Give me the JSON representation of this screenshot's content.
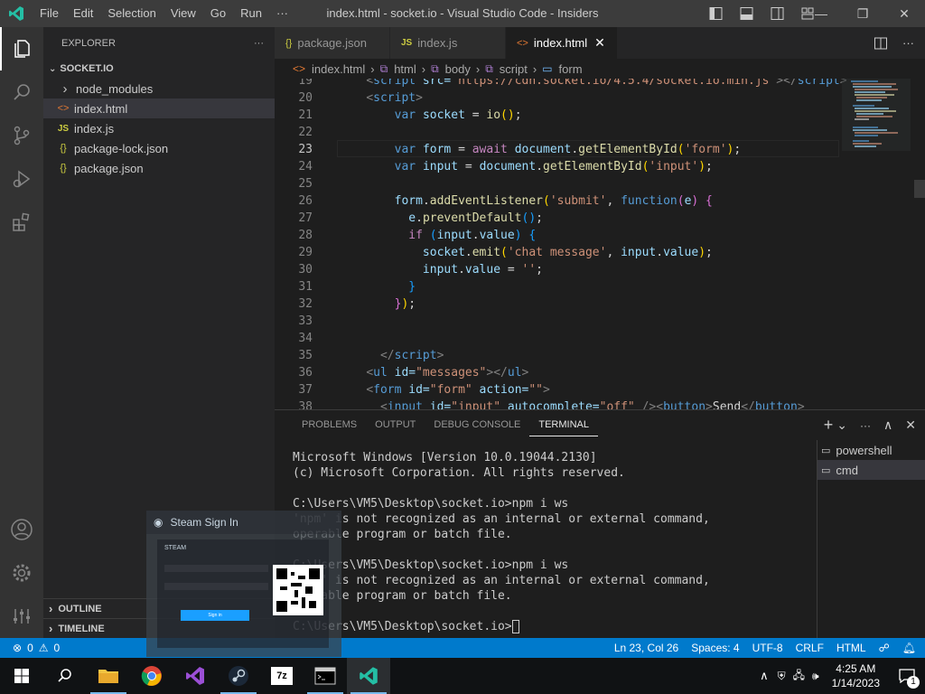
{
  "window": {
    "title": "index.html - socket.io - Visual Studio Code - Insiders",
    "menu": [
      "File",
      "Edit",
      "Selection",
      "View",
      "Go",
      "Run",
      "···"
    ]
  },
  "sidebar": {
    "title": "EXPLORER",
    "more": "···",
    "folder": "SOCKET.IO",
    "items": [
      {
        "label": "node_modules",
        "icon": "chevron-right-icon",
        "glyph": "›"
      },
      {
        "label": "index.html",
        "icon": "html-file-icon",
        "glyph": "<>"
      },
      {
        "label": "index.js",
        "icon": "js-file-icon",
        "glyph": "JS"
      },
      {
        "label": "package-lock.json",
        "icon": "json-file-icon",
        "glyph": "{}"
      },
      {
        "label": "package.json",
        "icon": "json-file-icon",
        "glyph": "{}"
      }
    ],
    "outline": "OUTLINE",
    "timeline": "TIMELINE"
  },
  "tabs": [
    {
      "label": "package.json",
      "glyph": "{}"
    },
    {
      "label": "index.js",
      "glyph": "JS"
    },
    {
      "label": "index.html",
      "glyph": "<>",
      "close": "✕"
    }
  ],
  "breadcrumbs": [
    "index.html",
    "html",
    "body",
    "script",
    "form"
  ],
  "editor": {
    "current_line": 23,
    "lines": [
      {
        "n": "19",
        "t": [
          [
            "    ",
            "t-pl"
          ],
          [
            "<",
            "t-br"
          ],
          [
            "script",
            "t-tag"
          ],
          [
            " src=",
            "t-attr"
          ],
          [
            "\"https://cdn.socket.io/4.5.4/socket.io.min.js\"",
            "t-str"
          ],
          [
            "></",
            "t-br"
          ],
          [
            "script",
            "t-tag"
          ],
          [
            ">",
            "t-br"
          ]
        ]
      },
      {
        "n": "20",
        "t": [
          [
            "    ",
            "t-pl"
          ],
          [
            "<",
            "t-br"
          ],
          [
            "script",
            "t-tag"
          ],
          [
            ">",
            "t-br"
          ]
        ]
      },
      {
        "n": "21",
        "t": [
          [
            "        ",
            "t-pl"
          ],
          [
            "var ",
            "t-kw"
          ],
          [
            "socket",
            "t-var"
          ],
          [
            " = ",
            "t-pl"
          ],
          [
            "io",
            "t-fn"
          ],
          [
            "()",
            "t-p1"
          ],
          [
            ";",
            "t-pl"
          ]
        ]
      },
      {
        "n": "22",
        "t": [
          [
            "",
            "t-pl"
          ]
        ]
      },
      {
        "n": "23",
        "t": [
          [
            "        ",
            "t-pl"
          ],
          [
            "var ",
            "t-kw"
          ],
          [
            "form",
            "t-var"
          ],
          [
            " = ",
            "t-pl"
          ],
          [
            "await ",
            "t-ctl"
          ],
          [
            "document",
            "t-var"
          ],
          [
            ".",
            "t-pl"
          ],
          [
            "getElementById",
            "t-fn"
          ],
          [
            "(",
            "t-p1"
          ],
          [
            "'form'",
            "t-str"
          ],
          [
            ")",
            "t-p1"
          ],
          [
            ";",
            "t-pl"
          ]
        ]
      },
      {
        "n": "24",
        "t": [
          [
            "        ",
            "t-pl"
          ],
          [
            "var ",
            "t-kw"
          ],
          [
            "input",
            "t-var"
          ],
          [
            " = ",
            "t-pl"
          ],
          [
            "document",
            "t-var"
          ],
          [
            ".",
            "t-pl"
          ],
          [
            "getElementById",
            "t-fn"
          ],
          [
            "(",
            "t-p1"
          ],
          [
            "'input'",
            "t-str"
          ],
          [
            ")",
            "t-p1"
          ],
          [
            ";",
            "t-pl"
          ]
        ]
      },
      {
        "n": "25",
        "t": [
          [
            "",
            "t-pl"
          ]
        ]
      },
      {
        "n": "26",
        "t": [
          [
            "        ",
            "t-pl"
          ],
          [
            "form",
            "t-var"
          ],
          [
            ".",
            "t-pl"
          ],
          [
            "addEventListener",
            "t-fn"
          ],
          [
            "(",
            "t-p1"
          ],
          [
            "'submit'",
            "t-str"
          ],
          [
            ", ",
            "t-pl"
          ],
          [
            "function",
            "t-kw"
          ],
          [
            "(",
            "t-p2"
          ],
          [
            "e",
            "t-var"
          ],
          [
            ")",
            "t-p2"
          ],
          [
            " {",
            "t-p2"
          ]
        ]
      },
      {
        "n": "27",
        "t": [
          [
            "          ",
            "t-pl"
          ],
          [
            "e",
            "t-var"
          ],
          [
            ".",
            "t-pl"
          ],
          [
            "preventDefault",
            "t-fn"
          ],
          [
            "()",
            "t-p3"
          ],
          [
            ";",
            "t-pl"
          ]
        ]
      },
      {
        "n": "28",
        "t": [
          [
            "          ",
            "t-pl"
          ],
          [
            "if ",
            "t-ctl"
          ],
          [
            "(",
            "t-p3"
          ],
          [
            "input",
            "t-var"
          ],
          [
            ".",
            "t-pl"
          ],
          [
            "value",
            "t-var"
          ],
          [
            ")",
            "t-p3"
          ],
          [
            " {",
            "t-p3"
          ]
        ]
      },
      {
        "n": "29",
        "t": [
          [
            "            ",
            "t-pl"
          ],
          [
            "socket",
            "t-var"
          ],
          [
            ".",
            "t-pl"
          ],
          [
            "emit",
            "t-fn"
          ],
          [
            "(",
            "t-p1"
          ],
          [
            "'chat message'",
            "t-str"
          ],
          [
            ", ",
            "t-pl"
          ],
          [
            "input",
            "t-var"
          ],
          [
            ".",
            "t-pl"
          ],
          [
            "value",
            "t-var"
          ],
          [
            ")",
            "t-p1"
          ],
          [
            ";",
            "t-pl"
          ]
        ]
      },
      {
        "n": "30",
        "t": [
          [
            "            ",
            "t-pl"
          ],
          [
            "input",
            "t-var"
          ],
          [
            ".",
            "t-pl"
          ],
          [
            "value",
            "t-var"
          ],
          [
            " = ",
            "t-pl"
          ],
          [
            "''",
            "t-str"
          ],
          [
            ";",
            "t-pl"
          ]
        ]
      },
      {
        "n": "31",
        "t": [
          [
            "          ",
            "t-pl"
          ],
          [
            "}",
            "t-p3"
          ]
        ]
      },
      {
        "n": "32",
        "t": [
          [
            "        ",
            "t-pl"
          ],
          [
            "}",
            "t-p2"
          ],
          [
            ")",
            "t-p1"
          ],
          [
            ";",
            "t-pl"
          ]
        ]
      },
      {
        "n": "33",
        "t": [
          [
            "",
            "t-pl"
          ]
        ]
      },
      {
        "n": "34",
        "t": [
          [
            "",
            "t-pl"
          ]
        ]
      },
      {
        "n": "35",
        "t": [
          [
            "      ",
            "t-pl"
          ],
          [
            "</",
            "t-br"
          ],
          [
            "script",
            "t-tag"
          ],
          [
            ">",
            "t-br"
          ]
        ]
      },
      {
        "n": "36",
        "t": [
          [
            "    ",
            "t-pl"
          ],
          [
            "<",
            "t-br"
          ],
          [
            "ul",
            "t-tag"
          ],
          [
            " id=",
            "t-attr"
          ],
          [
            "\"messages\"",
            "t-str"
          ],
          [
            "></",
            "t-br"
          ],
          [
            "ul",
            "t-tag"
          ],
          [
            ">",
            "t-br"
          ]
        ]
      },
      {
        "n": "37",
        "t": [
          [
            "    ",
            "t-pl"
          ],
          [
            "<",
            "t-br"
          ],
          [
            "form",
            "t-tag"
          ],
          [
            " id=",
            "t-attr"
          ],
          [
            "\"form\"",
            "t-str"
          ],
          [
            " action=",
            "t-attr"
          ],
          [
            "\"\"",
            "t-str"
          ],
          [
            ">",
            "t-br"
          ]
        ]
      },
      {
        "n": "38",
        "t": [
          [
            "      ",
            "t-pl"
          ],
          [
            "<",
            "t-br"
          ],
          [
            "input",
            "t-tag"
          ],
          [
            " id=",
            "t-attr"
          ],
          [
            "\"input\"",
            "t-str"
          ],
          [
            " autocomplete=",
            "t-attr"
          ],
          [
            "\"off\"",
            "t-str"
          ],
          [
            " /><",
            "t-br"
          ],
          [
            "button",
            "t-tag"
          ],
          [
            ">",
            "t-br"
          ],
          [
            "Send",
            "t-pl"
          ],
          [
            "</",
            "t-br"
          ],
          [
            "button",
            "t-tag"
          ],
          [
            ">",
            "t-br"
          ]
        ]
      }
    ]
  },
  "panel": {
    "tabs": [
      "PROBLEMS",
      "OUTPUT",
      "DEBUG CONSOLE",
      "TERMINAL"
    ],
    "active_tab": "TERMINAL",
    "actions": [
      "+",
      "⌄",
      "···",
      "∧",
      "✕"
    ],
    "terminal_lines": [
      "Microsoft Windows [Version 10.0.19044.2130]",
      "(c) Microsoft Corporation. All rights reserved.",
      "",
      "C:\\Users\\VM5\\Desktop\\socket.io>npm i ws",
      "'npm' is not recognized as an internal or external command,",
      "operable program or batch file.",
      "",
      "C:\\Users\\VM5\\Desktop\\socket.io>npm i ws",
      "'npm' is not recognized as an internal or external command,",
      "operable program or batch file.",
      "",
      "C:\\Users\\VM5\\Desktop\\socket.io>"
    ],
    "terminals": [
      {
        "label": "powershell",
        "icon": "terminal-icon"
      },
      {
        "label": "cmd",
        "icon": "terminal-icon"
      }
    ]
  },
  "status": {
    "errors": "0",
    "warnings": "0",
    "position": "Ln 23, Col 26",
    "spaces": "Spaces: 4",
    "encoding": "UTF-8",
    "eol": "CRLF",
    "language": "HTML"
  },
  "steam": {
    "title": "Steam Sign In",
    "brand": "STEAM",
    "signin": "Sign in"
  },
  "taskbar": {
    "time": "4:25 AM",
    "date": "1/14/2023",
    "notifications": "1",
    "apps": [
      "start",
      "search",
      "file-explorer",
      "chrome",
      "visual-studio",
      "steam",
      "7zip",
      "cmd",
      "vscode-insiders"
    ]
  },
  "colors": {
    "accent": "#007acc",
    "titlebar": "#3c3c3c",
    "activitybar": "#333333",
    "sidebar": "#252526",
    "editor": "#1e1e1e"
  }
}
